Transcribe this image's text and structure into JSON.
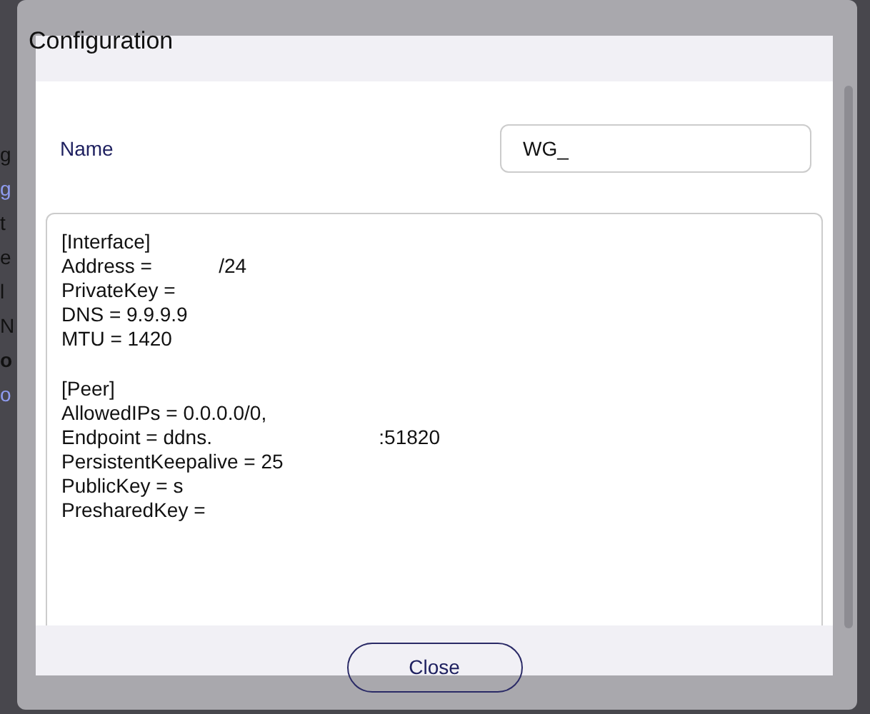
{
  "background_fragments": [
    {
      "text": "g",
      "kind": "text"
    },
    {
      "text": "g",
      "kind": "link"
    },
    {
      "text": "t",
      "kind": "text"
    },
    {
      "text": "e",
      "kind": "text"
    },
    {
      "text": "l",
      "kind": "text"
    },
    {
      "text": "N",
      "kind": "text"
    },
    {
      "text": "o",
      "kind": "bold"
    },
    {
      "text": "o",
      "kind": "link"
    }
  ],
  "dialog": {
    "title": "Configuration",
    "name_field": {
      "label": "Name",
      "value": "WG_"
    },
    "config_sections": [
      [
        "[Interface]",
        "Address =            /24",
        "PrivateKey =",
        "DNS = 9.9.9.9",
        "MTU = 1420"
      ],
      [
        "[Peer]",
        "AllowedIPs = 0.0.0.0/0,",
        "Endpoint = ddns.                              :51820",
        "PersistentKeepalive = 25",
        "PublicKey = s",
        "PresharedKey ="
      ]
    ],
    "buttons": [
      "Close"
    ]
  }
}
